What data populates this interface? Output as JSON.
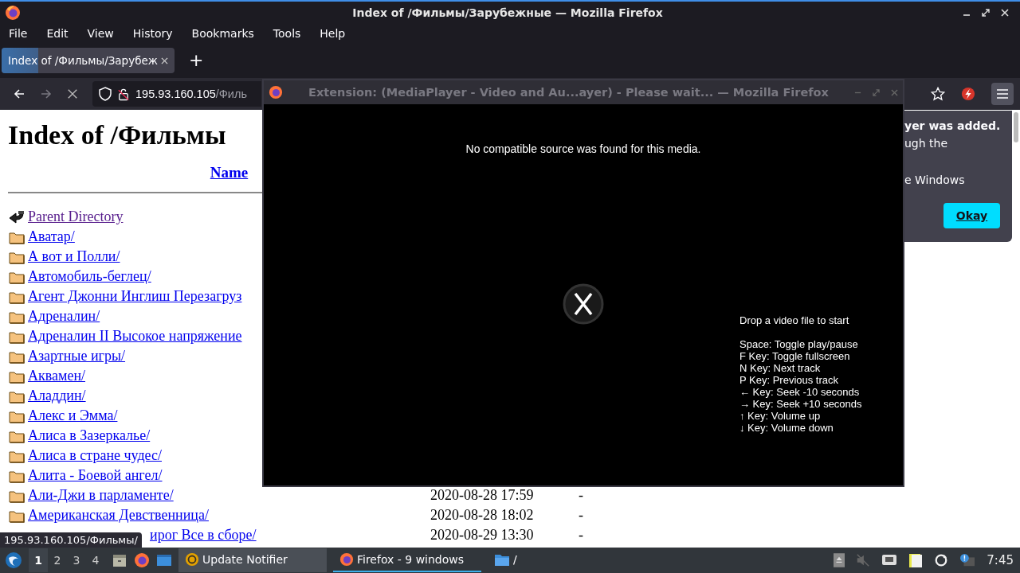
{
  "window": {
    "title": "Index of /Фильмы/Зарубежные — Mozilla Firefox"
  },
  "menu": [
    "File",
    "Edit",
    "View",
    "History",
    "Bookmarks",
    "Tools",
    "Help"
  ],
  "tabs": [
    {
      "label": "Index of /Фильмы/Зарубеж",
      "selected": true,
      "loading": true
    }
  ],
  "new_tab": "+",
  "nav": {
    "url_host": "195.93.160.105",
    "url_path": "/Филь"
  },
  "page": {
    "heading": "Index of /Фильмы",
    "columns": [
      "Name"
    ],
    "rows": [
      {
        "kind": "parent",
        "name": "Parent Directory",
        "visited": true
      },
      {
        "kind": "folder",
        "name": "Аватар/",
        "visited": false
      },
      {
        "kind": "folder",
        "name": "А вот и Полли/",
        "visited": false
      },
      {
        "kind": "folder",
        "name": "Автомобиль-беглец/",
        "visited": false
      },
      {
        "kind": "folder",
        "name": "Агент Джонни Инглиш Перезагруз",
        "visited": false
      },
      {
        "kind": "folder",
        "name": "Адреналин/",
        "visited": false
      },
      {
        "kind": "folder",
        "name": "Адреналин II Высокое напряжение",
        "visited": false
      },
      {
        "kind": "folder",
        "name": "Азартные игры/",
        "visited": false
      },
      {
        "kind": "folder",
        "name": "Аквамен/",
        "visited": false
      },
      {
        "kind": "folder",
        "name": "Аладдин/",
        "visited": false
      },
      {
        "kind": "folder",
        "name": "Алекс и Эмма/",
        "visited": false
      },
      {
        "kind": "folder",
        "name": "Алиса в Зазеркалье/",
        "visited": false
      },
      {
        "kind": "folder",
        "name": "Алиса в стране чудес/",
        "visited": false
      },
      {
        "kind": "folder",
        "name": "Алита - Боевой ангел/",
        "visited": false
      },
      {
        "kind": "folder",
        "name": "Али-Джи в парламенте/",
        "date": "2020-08-28 17:59",
        "size": "-",
        "visited": false
      },
      {
        "kind": "folder",
        "name": "Американская Девственница/",
        "date": "2020-08-28 18:02",
        "size": "-",
        "visited": false
      },
      {
        "kind": "covered",
        "name": "ирог Все в сборе/",
        "date": "2020-08-29 13:30",
        "size": "-",
        "visited": false
      }
    ]
  },
  "status_tooltip": "195.93.160.105/Фильмы/",
  "notification": {
    "title": "yer was added.",
    "lines": [
      "ugh the",
      "e Windows"
    ],
    "button": "Okay"
  },
  "player_window": {
    "title": "Extension: (MediaPlayer - Video and Au...ayer) - Please wait... — Mozilla Firefox",
    "message": "No compatible source was found for this media.",
    "hint": "Drop a video file to start",
    "shortcuts": [
      "Space: Toggle play/pause",
      "F Key: Toggle fullscreen",
      "N Key: Next track",
      "P Key: Previous track",
      "← Key: Seek -10 seconds",
      "→ Key: Seek +10 seconds",
      "↑ Key: Volume up",
      "↓ Key: Volume down"
    ]
  },
  "taskbar": {
    "workspaces": [
      {
        "label": "1",
        "selected": true
      },
      {
        "label": "2",
        "selected": false
      },
      {
        "label": "3",
        "selected": false
      },
      {
        "label": "4",
        "selected": false
      }
    ],
    "tasks": [
      {
        "kind": "update",
        "label": "Update Notifier",
        "selected": false,
        "hover": true
      },
      {
        "kind": "firefox",
        "label": "Firefox - 9 windows",
        "selected": true,
        "hover": false
      },
      {
        "kind": "folder",
        "label": "/",
        "selected": false,
        "hover": false
      }
    ],
    "clock": "7:45"
  }
}
